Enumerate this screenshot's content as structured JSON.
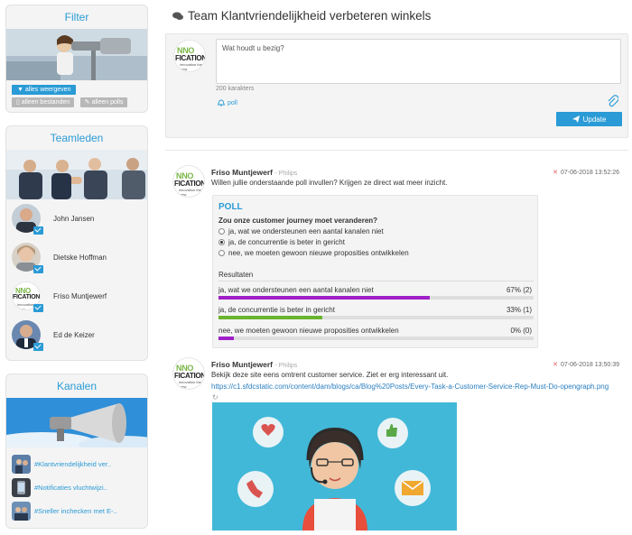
{
  "filter": {
    "title": "Filter",
    "show_all": "alles weergeven",
    "only_files": "alleen bestanden",
    "only_polls": "alleen polls"
  },
  "team": {
    "title": "Teamleden",
    "members": [
      {
        "name": "John Jansen"
      },
      {
        "name": "Dietske Hoffman"
      },
      {
        "name": "Friso Muntjewerf"
      },
      {
        "name": "Ed de Keizer"
      }
    ]
  },
  "channels": {
    "title": "Kanalen",
    "items": [
      {
        "label": "#Klantvriendelijkheid ver.."
      },
      {
        "label": "#Notificaties vluchtwijzi.."
      },
      {
        "label": "#Sneller inchecken met E-.."
      }
    ]
  },
  "main": {
    "title": "Team Klantvriendelijkheid verbeteren winkels",
    "composer": {
      "placeholder": "Wat houdt u bezig?",
      "counter": "200 karakters",
      "poll_label": "poll",
      "update_label": "Update"
    },
    "logo": {
      "line1": "NNO",
      "line2": "FICATION",
      "line3": "innovation the crew"
    }
  },
  "posts": [
    {
      "author": "Friso Muntjewerf",
      "company": "- Philips",
      "timestamp": "07-06-2018 13:52:26",
      "text": "Willen jullie onderstaande poll invullen? Krijgen ze direct wat meer inzicht.",
      "poll": {
        "title": "POLL",
        "question": "Zou onze customer journey moet veranderen?",
        "options": [
          {
            "label": "ja, wat we ondersteunen een aantal kanalen niet",
            "selected": false
          },
          {
            "label": "ja, de concurrentie is beter in gericht",
            "selected": true
          },
          {
            "label": "nee, we moeten gewoon nieuwe proposities ontwikkelen",
            "selected": false
          }
        ],
        "results_label": "Resultaten",
        "results": [
          {
            "label": "ja, wat we ondersteunen een aantal kanalen niet",
            "value": "67% (2)",
            "percent": 67,
            "color": "#a020c8"
          },
          {
            "label": "ja, de concurrentie is beter in gericht",
            "value": "33% (1)",
            "percent": 33,
            "color": "#6ab42e"
          },
          {
            "label": "nee, we moeten gewoon nieuwe proposities ontwikkelen",
            "value": "0% (0)",
            "percent": 5,
            "color": "#a020c8"
          }
        ]
      }
    },
    {
      "author": "Friso Muntjewerf",
      "company": "- Philips",
      "timestamp": "07-06-2018 13:50:39",
      "text": "Bekijk deze site eens omtrent customer service. Ziet er erg interessant uit.",
      "link": "https://c1.sfdcstatic.com/content/dam/blogs/ca/Blog%20Posts/Every-Task-a-Customer-Service-Rep-Must-Do-opengraph.png"
    }
  ]
}
